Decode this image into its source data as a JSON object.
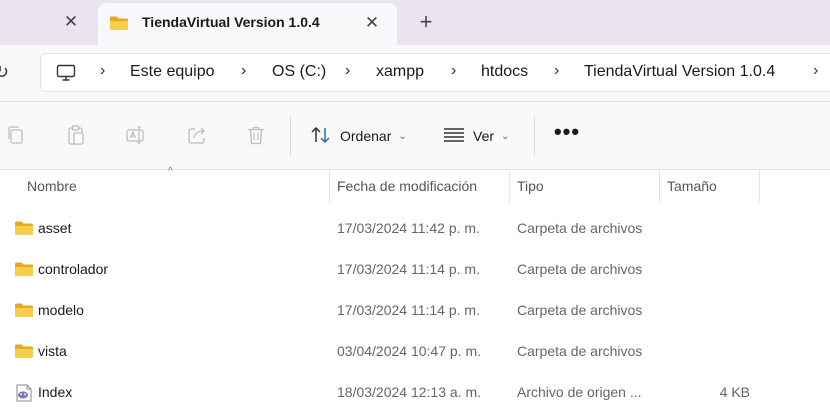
{
  "tabs": {
    "active_title": "TiendaVirtual Version 1.0.4",
    "close_glyph": "✕",
    "new_tab_glyph": "+"
  },
  "address": {
    "refresh_glyph": "↻",
    "separator": "›",
    "crumbs": [
      "Este equipo",
      "OS (C:)",
      "xampp",
      "htdocs",
      "TiendaVirtual Version 1.0.4"
    ]
  },
  "commands": {
    "sort_label": "Ordenar",
    "view_label": "Ver",
    "dropdown_glyph": "⌄",
    "more_glyph": "•••",
    "icons": [
      "copy-icon",
      "paste-icon",
      "rename-icon",
      "share-icon",
      "delete-icon",
      "sort-icon",
      "view-icon",
      "more-icon"
    ]
  },
  "columns": {
    "name": "Nombre",
    "modified": "Fecha de modificación",
    "type": "Tipo",
    "size": "Tamaño",
    "sort_indicator": "^"
  },
  "files": [
    {
      "name": "asset",
      "modified": "17/03/2024 11:42 p. m.",
      "type": "Carpeta de archivos",
      "size": "",
      "icon": "folder-icon"
    },
    {
      "name": "controlador",
      "modified": "17/03/2024 11:14 p. m.",
      "type": "Carpeta de archivos",
      "size": "",
      "icon": "folder-icon"
    },
    {
      "name": "modelo",
      "modified": "17/03/2024 11:14 p. m.",
      "type": "Carpeta de archivos",
      "size": "",
      "icon": "folder-icon"
    },
    {
      "name": "vista",
      "modified": "03/04/2024 10:47 p. m.",
      "type": "Carpeta de archivos",
      "size": "",
      "icon": "folder-icon"
    },
    {
      "name": "Index",
      "modified": "18/03/2024 12:13 a. m.",
      "type": "Archivo de origen ...",
      "size": "4 KB",
      "icon": "php-file-icon"
    }
  ],
  "colors": {
    "titlebar_bg": "#e9e4f0",
    "folder_yellow": "#f4c542",
    "accent_blue": "#2b6cb0"
  }
}
